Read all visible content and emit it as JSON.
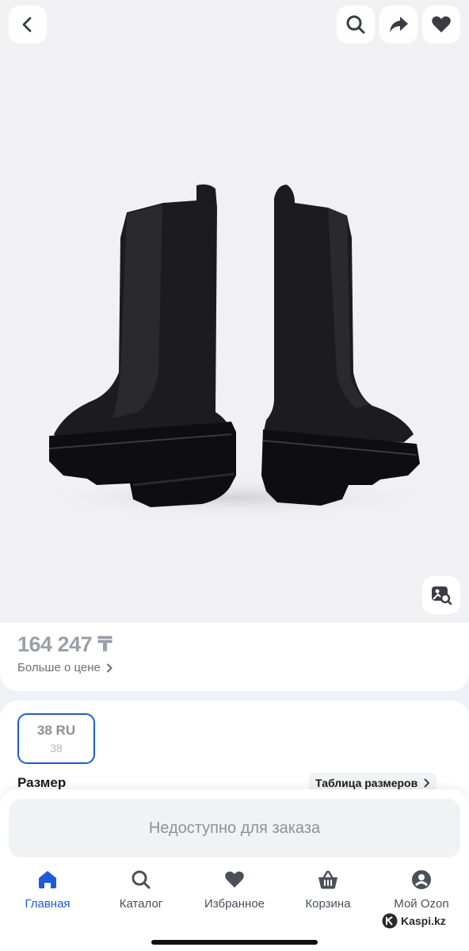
{
  "header": {
    "back_icon": "chevron-left-icon",
    "search_icon": "search-icon",
    "share_icon": "share-arrow-icon",
    "favorite_icon": "heart-icon",
    "visual_search_icon": "image-search-icon"
  },
  "product_image": {
    "subject": "black chelsea boots"
  },
  "price": {
    "value": "164 247 ₸",
    "more_label": "Больше о цене"
  },
  "size": {
    "selected_main": "38 RU",
    "selected_sub": "38",
    "label": "Размер",
    "table_label": "Таблица размеров"
  },
  "order": {
    "button_label": "Недоступно для заказа"
  },
  "nav": {
    "items": [
      {
        "label": "Главная",
        "icon": "home-icon",
        "active": true
      },
      {
        "label": "Каталог",
        "icon": "search-icon",
        "active": false
      },
      {
        "label": "Избранное",
        "icon": "heart-icon",
        "active": false
      },
      {
        "label": "Корзина",
        "icon": "basket-icon",
        "active": false
      },
      {
        "label": "Мой Ozon",
        "icon": "profile-icon",
        "active": false
      }
    ]
  },
  "watermark": {
    "text": "Kaspi.kz"
  },
  "colors": {
    "accent": "#1f5bd8",
    "background": "#eef1f6",
    "price_muted": "#9aa0a8"
  }
}
